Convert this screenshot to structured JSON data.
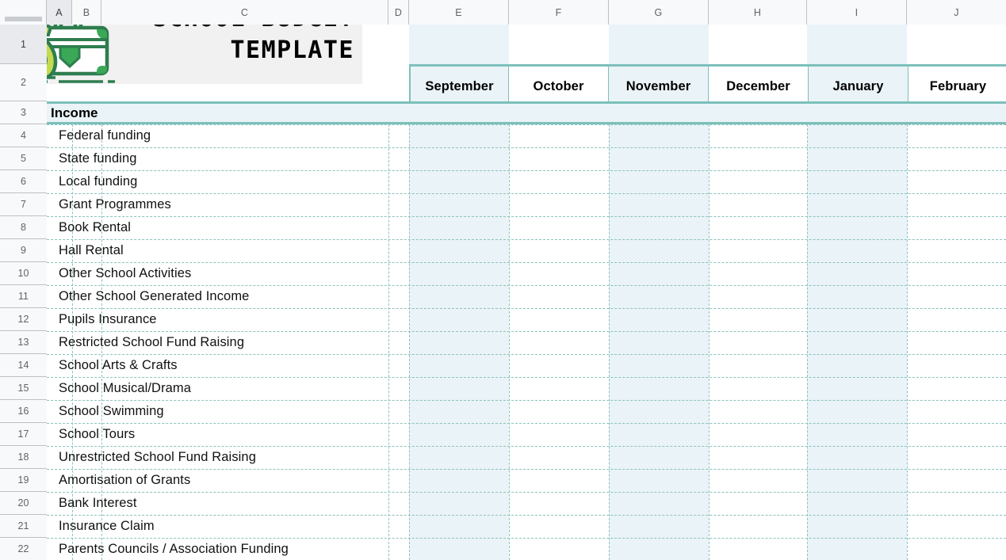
{
  "app": {
    "type": "spreadsheet"
  },
  "columns": {
    "headers": [
      "A",
      "B",
      "C",
      "D",
      "E",
      "F",
      "G",
      "H",
      "I",
      "J"
    ],
    "selected": "A"
  },
  "rows": {
    "numbers": [
      "1",
      "2",
      "3",
      "4",
      "5",
      "6",
      "7",
      "8",
      "9",
      "10",
      "11",
      "12",
      "13",
      "14",
      "15",
      "16",
      "17",
      "18",
      "19",
      "20",
      "21",
      "22"
    ],
    "selected": "1"
  },
  "title": {
    "line1": "SCHOOL BUDGET",
    "line2": "TEMPLATE",
    "full": "SCHOOL BUDGET\nTEMPLATE"
  },
  "logo": {
    "name": "money-bag-and-briefcase-illustration",
    "bag_color": "#c5d94f",
    "case_color": "#ffffff",
    "outline_color": "#2e7d4f",
    "accent_color": "#3aa856"
  },
  "months": [
    {
      "label": "September",
      "column": "E",
      "tint": true
    },
    {
      "label": "October",
      "column": "F",
      "tint": false
    },
    {
      "label": "November",
      "column": "G",
      "tint": true
    },
    {
      "label": "December",
      "column": "H",
      "tint": false
    },
    {
      "label": "January",
      "column": "I",
      "tint": true
    },
    {
      "label": "February",
      "column": "J",
      "tint": false
    }
  ],
  "section": {
    "label": "Income",
    "row": "3"
  },
  "items": [
    {
      "row": "4",
      "label": "Federal funding"
    },
    {
      "row": "5",
      "label": "State funding"
    },
    {
      "row": "6",
      "label": "Local funding"
    },
    {
      "row": "7",
      "label": "Grant Programmes"
    },
    {
      "row": "8",
      "label": "Book Rental"
    },
    {
      "row": "9",
      "label": "Hall Rental"
    },
    {
      "row": "10",
      "label": "Other School Activities"
    },
    {
      "row": "11",
      "label": "Other School Generated Income"
    },
    {
      "row": "12",
      "label": "Pupils Insurance"
    },
    {
      "row": "13",
      "label": "Restricted School Fund Raising"
    },
    {
      "row": "14",
      "label": "School Arts & Crafts"
    },
    {
      "row": "15",
      "label": "School Musical/Drama"
    },
    {
      "row": "16",
      "label": "School Swimming"
    },
    {
      "row": "17",
      "label": "School Tours"
    },
    {
      "row": "18",
      "label": "Unrestricted School Fund Raising"
    },
    {
      "row": "19",
      "label": "Amortisation of Grants"
    },
    {
      "row": "20",
      "label": "Bank Interest"
    },
    {
      "row": "21",
      "label": "Insurance Claim"
    },
    {
      "row": "22",
      "label": "Parents Councils / Association Funding"
    }
  ],
  "colors": {
    "teal_border": "#7cc0ba",
    "cell_tint": "#eaf3f7",
    "header_bg": "#f8f9fa",
    "header_selected": "#e8eaed",
    "title_block_bg": "#f1f1f1",
    "selection_blue": "#1a73e8"
  }
}
